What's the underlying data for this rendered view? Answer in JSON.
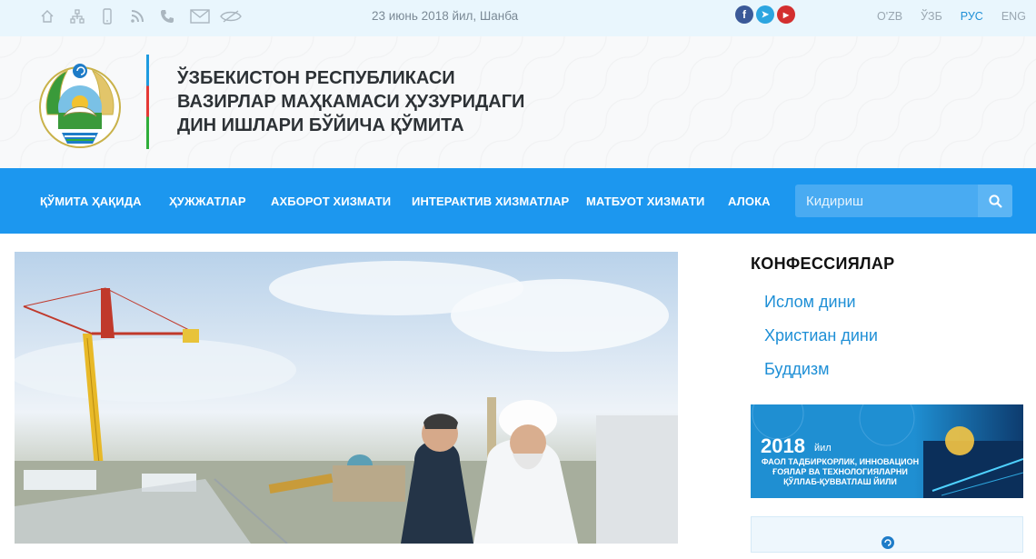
{
  "topbar": {
    "icons": [
      "home-icon",
      "sitemap-icon",
      "mobile-icon",
      "rss-icon",
      "phone-icon",
      "mail-icon",
      "low-vision-icon"
    ],
    "date": "23 июнь 2018 йил, Шанба",
    "social": [
      {
        "name": "facebook-icon",
        "glyph": "f",
        "color": "#3b5998"
      },
      {
        "name": "telegram-icon",
        "glyph": "➤",
        "color": "#2ca5e0"
      },
      {
        "name": "youtube-icon",
        "glyph": "▶",
        "color": "#d32f2f"
      }
    ],
    "languages": [
      "O'ZB",
      "ЎЗБ",
      "РУС",
      "ENG"
    ],
    "active_language": "РУС"
  },
  "header": {
    "title_lines": [
      "ЎЗБЕКИСТОН РЕСПУБЛИКАСИ",
      "ВАЗИРЛАР МАҲКАМАСИ ҲУЗУРИДАГИ",
      "ДИН ИШЛАРИ БЎЙИЧА ҚЎМИТА"
    ]
  },
  "nav": {
    "items": [
      "ҚЎМИТА ҲАҚИДА",
      "ҲУЖЖАТЛАР",
      "АХБОРОТ ХИЗМАТИ",
      "ИНТЕРАКТИВ ХИЗМАТЛАР",
      "МАТБУОТ ХИЗМАТИ",
      "АЛОКА"
    ],
    "search_placeholder": "Кидириш"
  },
  "sidebar": {
    "title": "КОНФЕССИЯЛАР",
    "links": [
      "Ислом дини",
      "Христиан дини",
      "Буддизм"
    ],
    "banner": {
      "year": "2018",
      "year_suffix": "йил",
      "text": "ФАОЛ ТАДБИРКОРЛИК, ИННОВАЦИОН ҒОЯЛАР ВА ТЕХНОЛОГИЯЛАРНИ ҚЎЛЛАБ-ҚУВВАТЛАШ ЙИЛИ"
    }
  },
  "colors": {
    "accent": "#1c97ef",
    "topbar_bg": "#e9f6fd",
    "link": "#1e8fd6"
  }
}
